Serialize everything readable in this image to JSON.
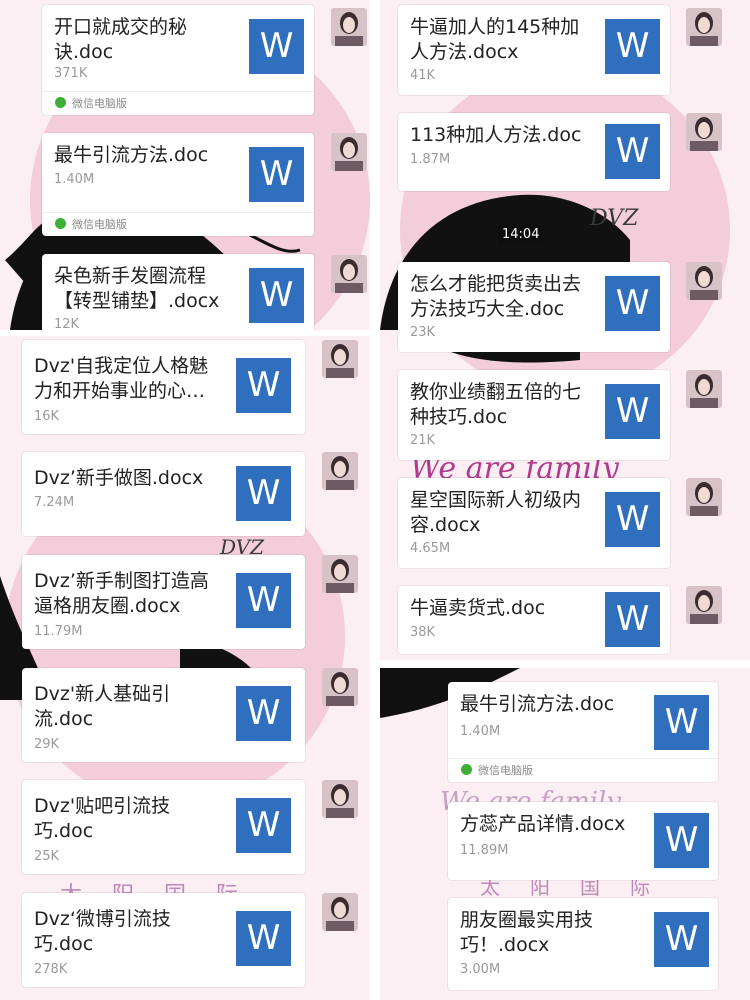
{
  "colors": {
    "word_icon": "#2f6fbd",
    "bubble": "#ffffff",
    "wechat_green": "#3cb034",
    "background_pink": "#fbeff3"
  },
  "icon_glyph": "W",
  "source_label": "微信电脑版",
  "timestamp": "14:04",
  "panel_a": {
    "files": [
      {
        "name": "开口就成交的秘\n诀.doc",
        "size": "371K"
      },
      {
        "name": "最牛引流方法.doc",
        "size": "1.40M"
      },
      {
        "name": "朵色新手发圈流程\n【转型铺垫】.docx",
        "size": "12K"
      }
    ]
  },
  "panel_b": {
    "files": [
      {
        "name": "牛逼加人的145种加\n人方法.docx",
        "size": "41K"
      },
      {
        "name": "113种加人方法.doc",
        "size": "1.87M"
      },
      {
        "name": "怎么才能把货卖出去\n方法技巧大全.doc",
        "size": "23K"
      },
      {
        "name": "教你业绩翻五倍的七\n种技巧.doc",
        "size": "21K"
      },
      {
        "name": "星空国际新人初级内\n容.docx",
        "size": "4.65M"
      },
      {
        "name": "牛逼卖货式.doc",
        "size": "38K"
      }
    ]
  },
  "panel_c": {
    "files": [
      {
        "name": "Dvz'自我定位人格魅\n力和开始事业的心…",
        "size": "16K"
      },
      {
        "name": "Dvz’新手做图.docx",
        "size": "7.24M"
      },
      {
        "name": "Dvz’新手制图打造高\n逼格朋友圈.docx",
        "size": "11.79M"
      },
      {
        "name": "Dvz'新人基础引\n流.doc",
        "size": "29K"
      },
      {
        "name": "Dvz'贴吧引流技\n巧.doc",
        "size": "25K"
      },
      {
        "name": "Dvz‘微博引流技\n巧.doc",
        "size": "278K"
      }
    ]
  },
  "panel_d": {
    "files": [
      {
        "name": "最牛引流方法.doc",
        "size": "1.40M"
      },
      {
        "name": "方蕊产品详情.docx",
        "size": "11.89M"
      },
      {
        "name": "朋友圈最实用技\n巧！.docx",
        "size": "3.00M"
      }
    ]
  }
}
